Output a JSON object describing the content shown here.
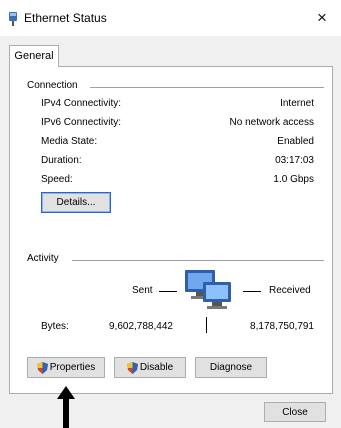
{
  "window": {
    "title": "Ethernet Status",
    "close_glyph": "×"
  },
  "tabs": [
    {
      "label": "General",
      "selected": true
    }
  ],
  "connection": {
    "header": "Connection",
    "rows": [
      {
        "label": "IPv4 Connectivity:",
        "value": "Internet"
      },
      {
        "label": "IPv6 Connectivity:",
        "value": "No network access"
      },
      {
        "label": "Media State:",
        "value": "Enabled"
      },
      {
        "label": "Duration:",
        "value": "03:17:03"
      },
      {
        "label": "Speed:",
        "value": "1.0 Gbps"
      }
    ],
    "details_button": "Details..."
  },
  "activity": {
    "header": "Activity",
    "sent_label": "Sent",
    "received_label": "Received",
    "bytes_label": "Bytes:",
    "bytes_sent": "9,602,788,442",
    "bytes_received": "8,178,750,791",
    "network_icon": "network-computers-icon"
  },
  "buttons": {
    "properties": "Properties",
    "disable": "Disable",
    "diagnose": "Diagnose",
    "close": "Close"
  },
  "icons": {
    "shield": "uac-shield-icon",
    "app": "ethernet-plug-icon",
    "arrow": "up-arrow-icon"
  }
}
